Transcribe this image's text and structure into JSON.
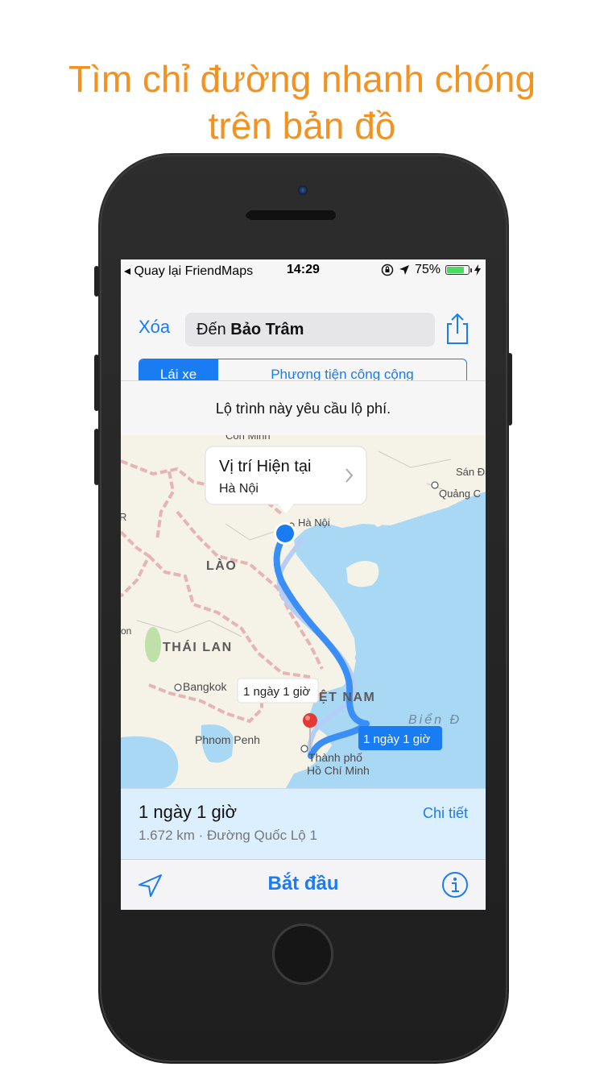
{
  "headline": {
    "line1": "Tìm chỉ đường nhanh chóng",
    "line2": "trên bản đồ",
    "color": "#f39220"
  },
  "status_bar": {
    "back_text": "◂ Quay lại FriendMaps",
    "time": "14:29",
    "battery_percent": "75%",
    "battery_level": 0.75
  },
  "nav": {
    "clear_label": "Xóa",
    "destination_prefix": "Đến",
    "destination_name": "Bảo Trâm",
    "share_icon": "share-icon"
  },
  "mode_tabs": [
    {
      "label": "Lái xe",
      "active": true
    },
    {
      "label": "Phương tiện công cộng",
      "active": false
    }
  ],
  "toll_notice": "Lộ trình này yêu cầu lộ phí.",
  "map": {
    "callout_title": "Vị trí Hiện tại",
    "callout_subtitle": "Hà Nội",
    "labels": {
      "con_minh": "Côn Minh",
      "san_dau": "Sán Đầ",
      "quang_chau": "Quảng C",
      "ha_noi": "Hà Nội",
      "lao": "LÀO",
      "thai_lan": "THÁI LAN",
      "bangkok": "Bangkok",
      "viet_nam": "ỆT NAM",
      "phnom_penh": "Phnom Penh",
      "hcm_line1": "Thành phố",
      "hcm_line2": "Hồ Chí Minh",
      "bien_dong": "Biển Đ",
      "on": "on"
    },
    "alt_route_label": "1 ngày 1 giờ",
    "main_route_label": "1 ngày 1 giờ",
    "colors": {
      "sea": "#a9d8f4",
      "land": "#f5f2e8",
      "route": "#3a8ef6",
      "border": "#e6b4b4"
    }
  },
  "route_summary": {
    "duration": "1 ngày 1 giờ",
    "details": "1.672 km · Đường Quốc Lộ 1",
    "detail_link": "Chi tiết"
  },
  "toolbar": {
    "start_label": "Bắt đầu",
    "location_icon": "location-arrow-icon",
    "info_icon": "info-icon"
  }
}
